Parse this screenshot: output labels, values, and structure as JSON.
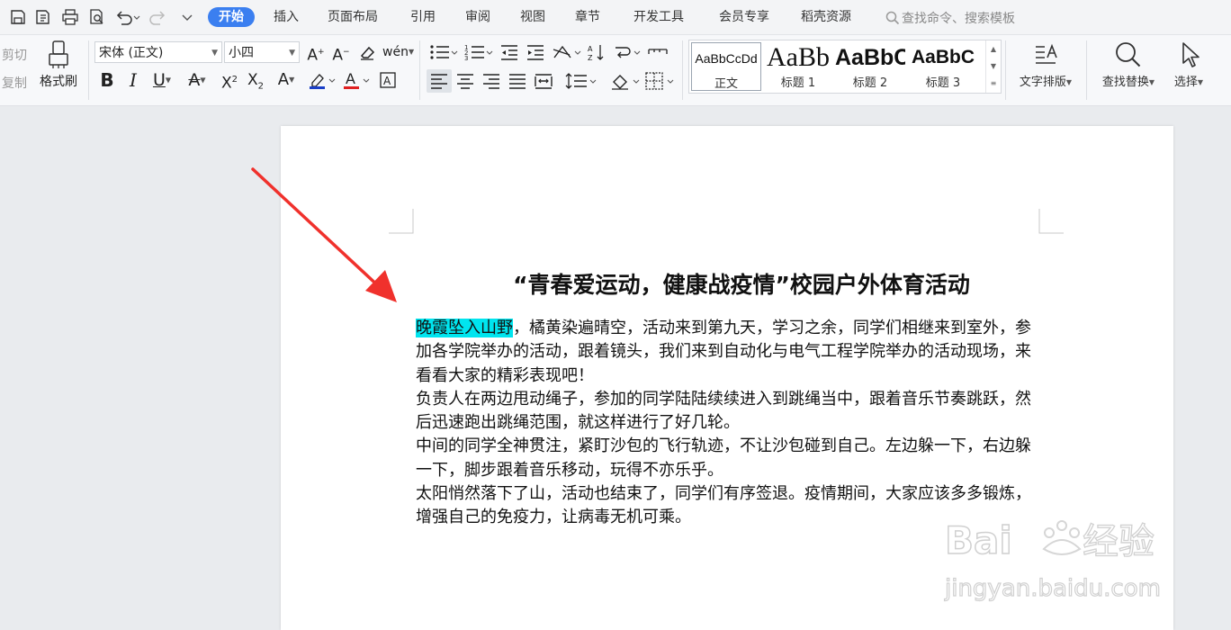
{
  "quick_access": {
    "icons": [
      "save-icon",
      "save-as-icon",
      "print-icon",
      "print-preview-icon",
      "undo-icon",
      "redo-icon",
      "customize-icon"
    ]
  },
  "tabs": [
    {
      "label": "开始",
      "active": true
    },
    {
      "label": "插入"
    },
    {
      "label": "页面布局"
    },
    {
      "label": "引用"
    },
    {
      "label": "审阅"
    },
    {
      "label": "视图"
    },
    {
      "label": "章节"
    },
    {
      "label": "开发工具"
    },
    {
      "label": "会员专享"
    },
    {
      "label": "稻壳资源"
    }
  ],
  "search": {
    "placeholder": "查找命令、搜索模板"
  },
  "clipboard": {
    "cut": "剪切",
    "copy": "复制",
    "format_painter": "格式刷"
  },
  "font": {
    "family": "宋体 (正文)",
    "size": "小四"
  },
  "styles": {
    "items": [
      {
        "preview": "AaBbCcDd",
        "label": "正文"
      },
      {
        "preview": "AaBb",
        "label": "标题 1"
      },
      {
        "preview": "AaBbC",
        "label": "标题 2"
      },
      {
        "preview": "AaBbC",
        "label": "标题 3"
      }
    ]
  },
  "tools": {
    "text_layout": "文字排版",
    "find_replace": "查找替换",
    "select": "选择"
  },
  "document": {
    "title": "“青春爱运动，健康战疫情”校园户外体育活动",
    "highlight": "晚霞坠入山野",
    "para1_rest": "，橘黄染遍晴空，活动来到第九天，学习之余，同学们相继来到室外，参加各学院举办的活动，跟着镜头，我们来到自动化与电气工程学院举办的活动现场，来看看大家的精彩表现吧！",
    "para2": "负责人在两边甩动绳子，参加的同学陆陆续续进入到跳绳当中，跟着音乐节奏跳跃，然后迅速跑出跳绳范围，就这样进行了好几轮。",
    "para3": "中间的同学全神贯注，紧盯沙包的飞行轨迹，不让沙包碰到自己。左边躲一下，右边躲一下，脚步跟着音乐移动，玩得不亦乐乎。",
    "para4": "太阳悄然落下了山，活动也结束了，同学们有序签退。疫情期间，大家应该多多锻炼，增强自己的免疫力，让病毒无机可乘。"
  },
  "watermark": {
    "brand": "Baidu经验",
    "url": "jingyan.baidu.com"
  },
  "colors": {
    "accent": "#3b7ff0",
    "highlight": "#00e5ef",
    "arrow": "#f0312c"
  }
}
